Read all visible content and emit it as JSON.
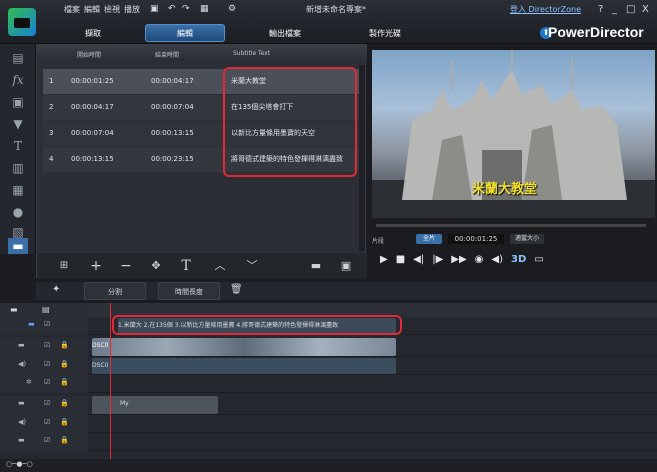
{
  "menu": [
    "檔案",
    "編輯",
    "檢視",
    "播放"
  ],
  "document_title": "新增未命名專案*",
  "login_link": "登入 DirectorZone",
  "window_controls": [
    "?",
    "_",
    "□",
    "X"
  ],
  "mode_tabs": [
    {
      "label": "擷取",
      "active": false
    },
    {
      "label": "編輯",
      "active": true
    },
    {
      "label": "輸出檔案",
      "active": false
    },
    {
      "label": "製作光碟",
      "active": false
    }
  ],
  "brand": "PowerDirector",
  "subtitle_panel": {
    "columns": [
      "開始時間",
      "結束時間",
      "Subtitle Text"
    ],
    "rows": [
      {
        "index": "1",
        "start": "00:00:01:25",
        "end": "00:00:04:17",
        "text": "米蘭大教堂",
        "selected": true
      },
      {
        "index": "2",
        "start": "00:00:04:17",
        "end": "00:00:07:04",
        "text": "在135個尖塔會打下",
        "selected": false
      },
      {
        "index": "3",
        "start": "00:00:07:04",
        "end": "00:00:13:15",
        "text": "以新比方量條用墨寶的天空",
        "selected": false
      },
      {
        "index": "4",
        "start": "00:00:13:15",
        "end": "00:00:23:15",
        "text": "將哥德式建築的特色發揮得淋漓盡致",
        "selected": false
      }
    ]
  },
  "preview": {
    "subtitle_overlay": "米蘭大教堂",
    "clip_label": "片段",
    "scope_label": "全片",
    "timecode": "00:00:01:25",
    "quality_label": "適當大小",
    "volume_label": "3D"
  },
  "actions": [
    "分割",
    "時間長度"
  ],
  "timeline": {
    "subtitle_clip_text": "1.米蘭大 2.在135個 3.以新比方量條用墨寶 4.將哥德式建築的特色發揮得淋漓盡致",
    "video_clip_label": "DSC0",
    "audio_clip_label": "DSC0",
    "title_clip_label": "My"
  },
  "colors": {
    "accent": "#e02a3a",
    "highlight": "#3a6fa8",
    "subtitle_yellow": "#f0e030"
  }
}
